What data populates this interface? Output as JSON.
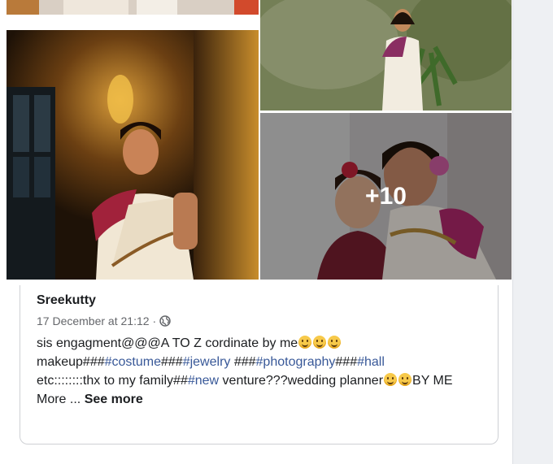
{
  "post": {
    "author": "Sreekutty",
    "date": "17 December at 21:12",
    "separator": " ·",
    "privacy_icon": "globe-icon",
    "more_photos_count": "+10",
    "text": {
      "l1": "sis engagment@@@A TO Z cordinate by me",
      "l2_a": "makeup###",
      "l2_tag1": "#costume",
      "l2_b": "###",
      "l2_tag2": "#jewelry",
      "l2_c": " ###",
      "l2_tag3": "#photography",
      "l2_d": "###",
      "l2_tag4": "#hall",
      "l3_a": "etc::::::::thx to my family##",
      "l3_tag": "#new",
      "l3_b": " venture???wedding planner",
      "l3_c": "BY ME",
      "more": "More ... ",
      "see_more": "See more"
    }
  },
  "colors": {
    "link": "#385898",
    "meta": "#65676b",
    "border": "#ced0d4"
  }
}
